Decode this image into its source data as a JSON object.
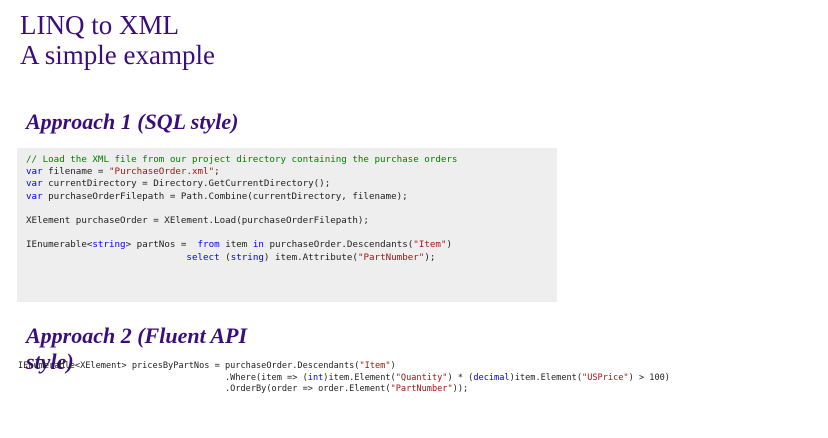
{
  "slide": {
    "title_line1": "LINQ to XML",
    "title_line2": "A simple example",
    "approach1": {
      "label_prefix": "Approach 1 (",
      "label_highlight": "SQL style",
      "label_suffix": ")"
    },
    "approach2": {
      "label_line1": "Approach 2 (Fluent API",
      "label_line2": "style)"
    }
  },
  "code1": {
    "comment": "// Load the XML file from our project directory containing the purchase orders",
    "l2_kw": "var",
    "l2_a": " filename = ",
    "l2_str": "\"PurchaseOrder.xml\"",
    "l2_b": ";",
    "l3_kw": "var",
    "l3_a": " currentDirectory = Directory.GetCurrentDirectory();",
    "l4_kw": "var",
    "l4_a": " purchaseOrderFilepath = Path.Combine(currentDirectory, filename);",
    "l5_a": "XElement purchaseOrder = XElement.Load(purchaseOrderFilepath);",
    "l6_a": "IEnumerable<",
    "l6_kw1": "string",
    "l6_b": "> partNos =  ",
    "l6_kw2": "from",
    "l6_c": " item ",
    "l6_kw3": "in",
    "l6_d": " purchaseOrder.Descendants(",
    "l6_str": "\"Item\"",
    "l6_e": ")",
    "l7_indent": "                             ",
    "l7_kw1": "select",
    "l7_a": " (",
    "l7_kw2": "string",
    "l7_b": ") item.Attribute(",
    "l7_str": "\"PartNumber\"",
    "l7_c": ");"
  },
  "code2": {
    "l1_a": "IEnumerable<XElement> pricesByPartNos = purchaseOrder.Descendants(",
    "l1_str": "\"Item\"",
    "l1_b": ")",
    "l2_indent": "                                        ",
    "l2_a": ".Where(item => (",
    "l2_kw1": "int",
    "l2_b": ")item.Element(",
    "l2_str1": "\"Quantity\"",
    "l2_c": ") * (",
    "l2_kw2": "decimal",
    "l2_d": ")item.Element(",
    "l2_str2": "\"USPrice\"",
    "l2_e": ") > 100)",
    "l3_indent": "                                        ",
    "l3_a": ".OrderBy(order => order.Element(",
    "l3_str": "\"PartNumber\"",
    "l3_b": "));"
  },
  "colors": {
    "heading": "#3a0d7a",
    "keyword": "#0000ff",
    "string": "#a31515",
    "comment": "#008000",
    "code_background": "#eeeeee"
  }
}
